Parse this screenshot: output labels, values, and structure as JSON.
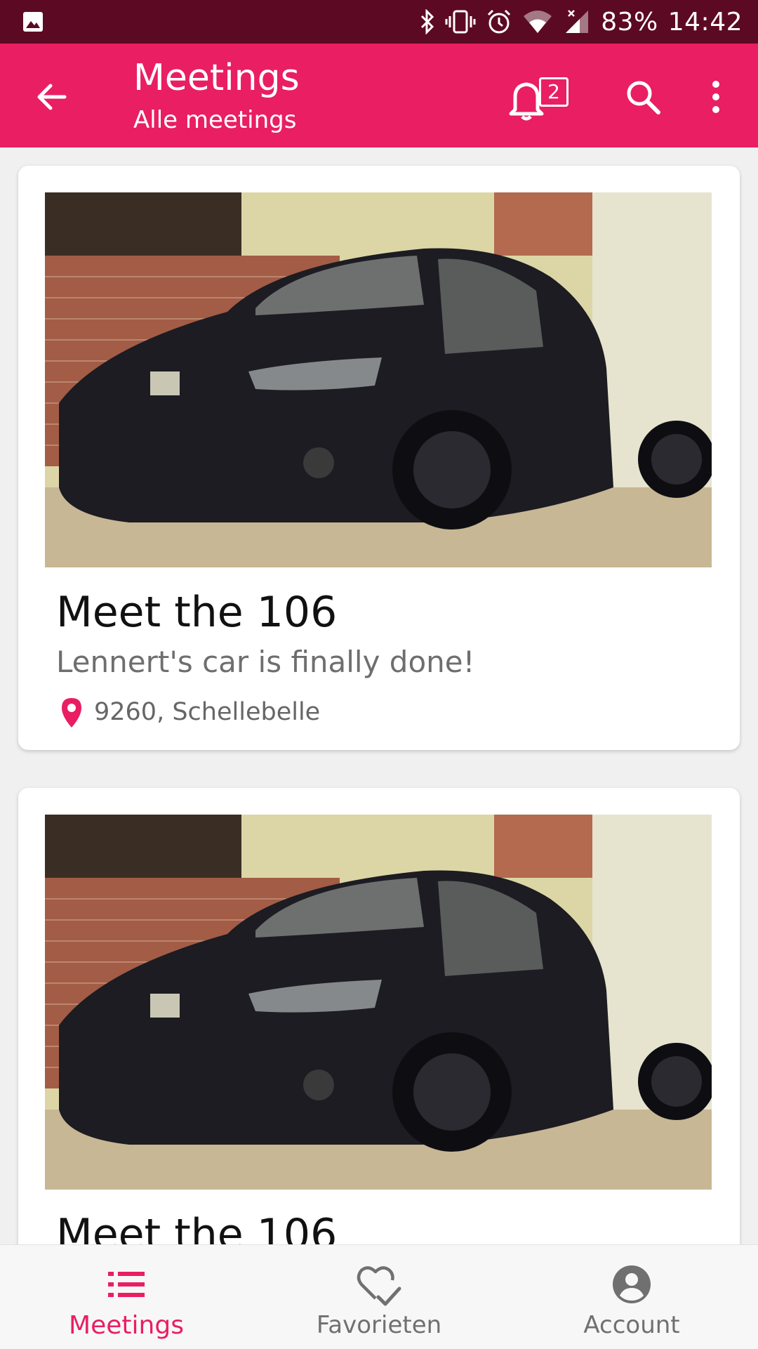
{
  "status_bar": {
    "battery": "83%",
    "time": "14:42",
    "icons": [
      "image-icon",
      "bluetooth-icon",
      "vibrate-icon",
      "alarm-icon",
      "wifi-icon",
      "signal-icon"
    ]
  },
  "app_bar": {
    "title": "Meetings",
    "subtitle": "Alle meetings",
    "notification_count": "2",
    "icons": [
      "back-arrow-icon",
      "bell-icon",
      "search-icon",
      "more-vert-icon"
    ]
  },
  "meetings": [
    {
      "title": "Meet the 106",
      "description": "Lennert's car is finally done!",
      "location": "9260, Schellebelle",
      "image": "car-photo"
    },
    {
      "title": "Meet the 106",
      "image": "car-photo"
    }
  ],
  "bottom_nav": {
    "items": [
      {
        "label": "Meetings",
        "icon": "list-icon",
        "active": true
      },
      {
        "label": "Favorieten",
        "icon": "heart-check-icon",
        "active": false
      },
      {
        "label": "Account",
        "icon": "account-circle-icon",
        "active": false
      }
    ]
  },
  "colors": {
    "primary": "#e91e63",
    "status_bar": "#5c0a24",
    "text_secondary": "#6e6e6e"
  }
}
